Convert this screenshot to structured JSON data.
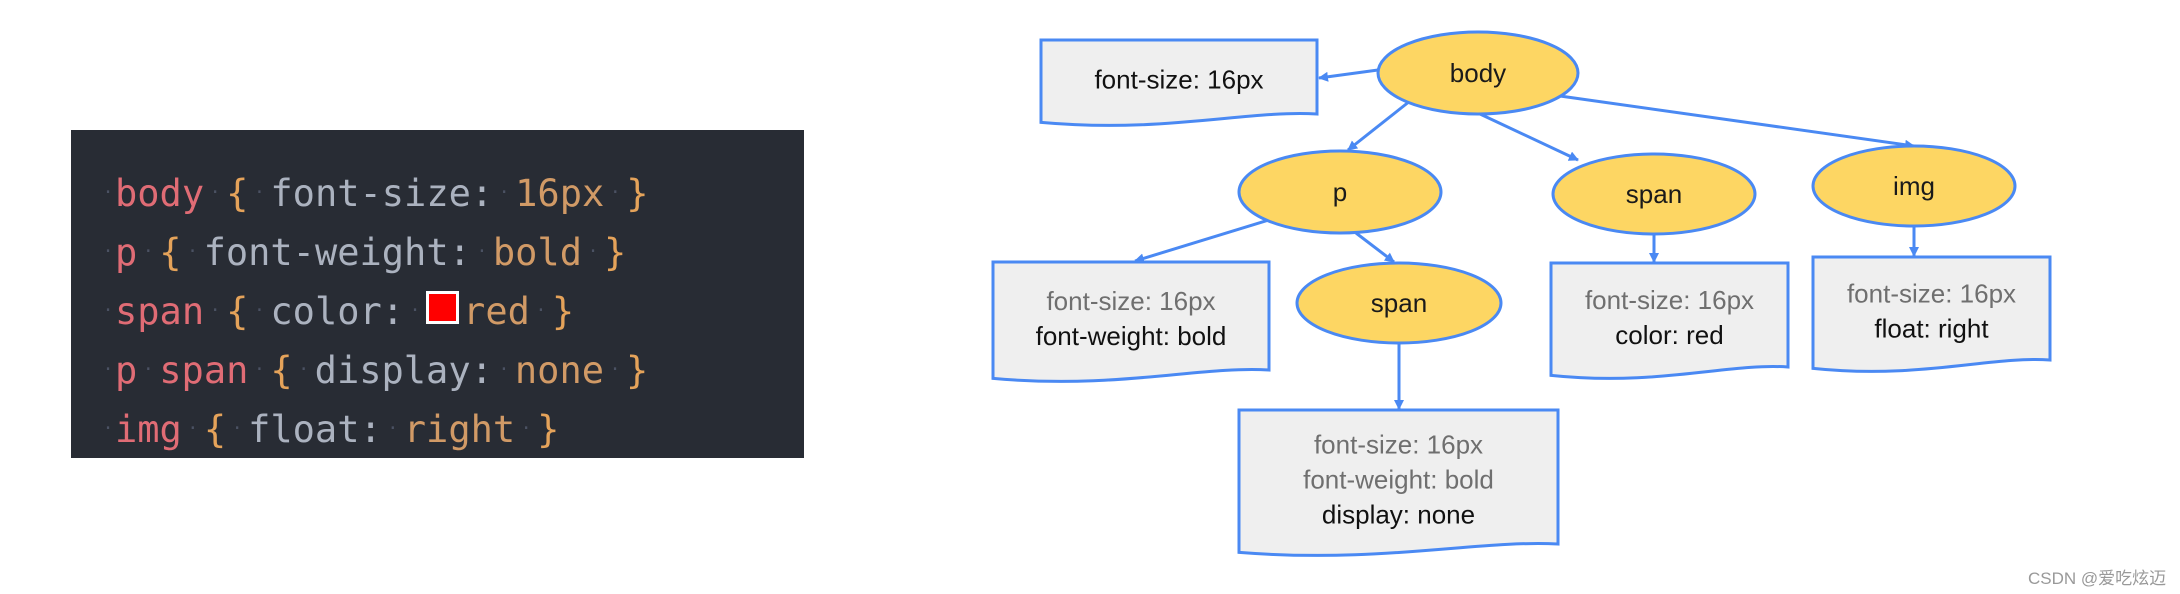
{
  "code": {
    "lines": [
      {
        "selector": "body",
        "property": "font-size:",
        "value": "16px",
        "open": "{",
        "close": "}"
      },
      {
        "selector": "p",
        "property": "font-weight:",
        "value": "bold",
        "open": "{",
        "close": "}"
      },
      {
        "selector": "span",
        "property": "color:",
        "value": "red",
        "open": "{",
        "close": "}",
        "swatch_color": "#ff0000"
      },
      {
        "selector_parts": [
          "p",
          "span"
        ],
        "property": "display:",
        "value": "none",
        "open": "{",
        "close": "}"
      },
      {
        "selector": "img",
        "property": "float:",
        "value": "right",
        "open": "{",
        "close": "}"
      }
    ]
  },
  "diagram": {
    "colors": {
      "node_fill": "#fdd663",
      "stroke": "#4a89f3",
      "doc_fill": "#efefef"
    },
    "nodes": [
      {
        "id": "body",
        "label": "body"
      },
      {
        "id": "p",
        "label": "p"
      },
      {
        "id": "span",
        "label": "span"
      },
      {
        "id": "img",
        "label": "img"
      },
      {
        "id": "p-span",
        "label": "span"
      }
    ],
    "styles": [
      {
        "id": "body-style",
        "for": "body",
        "inherited": [],
        "own": [
          "font-size: 16px"
        ]
      },
      {
        "id": "p-style",
        "for": "p",
        "inherited": [
          "font-size: 16px"
        ],
        "own": [
          "font-weight: bold"
        ]
      },
      {
        "id": "span-style",
        "for": "span",
        "inherited": [
          "font-size: 16px"
        ],
        "own": [
          "color: red"
        ]
      },
      {
        "id": "img-style",
        "for": "img",
        "inherited": [
          "font-size: 16px"
        ],
        "own": [
          "float: right"
        ]
      },
      {
        "id": "p-span-style",
        "for": "p-span",
        "inherited": [
          "font-size: 16px",
          "font-weight: bold"
        ],
        "own": [
          "display: none"
        ]
      }
    ],
    "edges": [
      {
        "from": "body",
        "to": "body-style"
      },
      {
        "from": "body",
        "to": "p"
      },
      {
        "from": "body",
        "to": "span"
      },
      {
        "from": "body",
        "to": "img"
      },
      {
        "from": "p",
        "to": "p-style"
      },
      {
        "from": "p",
        "to": "p-span"
      },
      {
        "from": "span",
        "to": "span-style"
      },
      {
        "from": "img",
        "to": "img-style"
      },
      {
        "from": "p-span",
        "to": "p-span-style"
      }
    ]
  },
  "watermark": "CSDN @爱吃炫迈"
}
